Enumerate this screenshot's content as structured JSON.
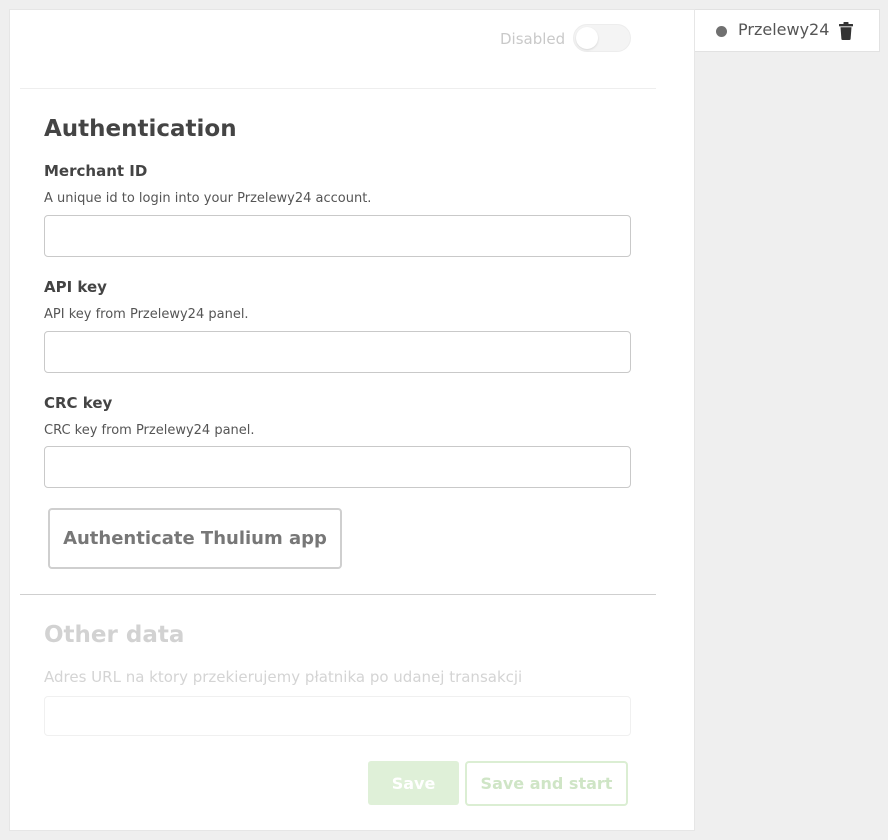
{
  "tab": {
    "label": "Przelewy24",
    "status_color": "#707070",
    "delete_icon": "trash-icon"
  },
  "status_toggle": {
    "label": "Disabled",
    "enabled": false
  },
  "authentication": {
    "title": "Authentication",
    "fields": [
      {
        "label": "Merchant ID",
        "help": "A unique id to login into your Przelewy24 account.",
        "value": "",
        "placeholder": ""
      },
      {
        "label": "API key",
        "help": "API key from Przelewy24 panel.",
        "value": "",
        "placeholder": ""
      },
      {
        "label": "CRC key",
        "help": "CRC key from Przelewy24 panel.",
        "value": "",
        "placeholder": ""
      }
    ],
    "authenticate_button": "Authenticate Thulium app"
  },
  "other_data": {
    "title": "Other data",
    "url_label": "Adres URL na ktory przekierujemy płatnika po udanej transakcji",
    "url_value": ""
  },
  "actions": {
    "save": "Save",
    "save_and_start": "Save and start"
  },
  "colors": {
    "accent_green_disabled": "#dff0d8",
    "panel_bg": "#ffffff",
    "page_bg": "#efefef"
  }
}
